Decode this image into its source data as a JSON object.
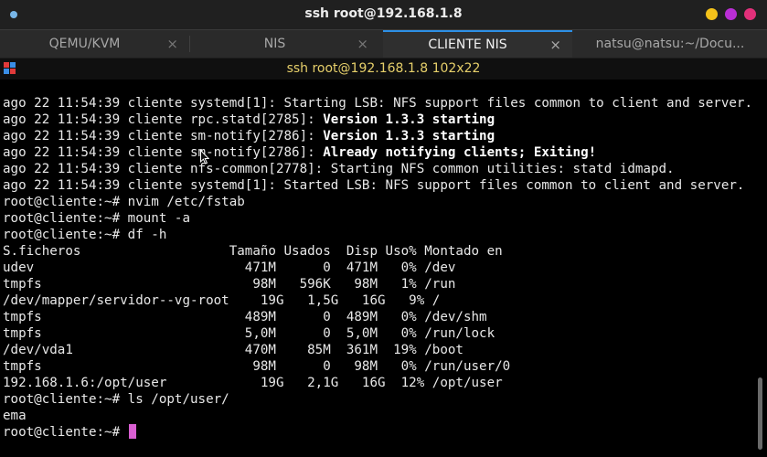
{
  "window": {
    "title": "ssh root@192.168.1.8",
    "buttons": {
      "minimize_color": "#f4c21a",
      "maximize_color": "#b92ed5",
      "close_color": "#e2307a"
    }
  },
  "tabs": [
    {
      "label": "QEMU/KVM",
      "active": false,
      "close_icon": "×"
    },
    {
      "label": "NIS",
      "active": false,
      "close_icon": "×"
    },
    {
      "label": "CLIENTE NIS",
      "active": true,
      "close_icon": "×"
    },
    {
      "label": "natsu@natsu:~/Docu...",
      "active": false,
      "close_icon": "×"
    }
  ],
  "terminal_header": {
    "title": "ssh root@192.168.1.8 102x22",
    "icon": "terminal-app-icon"
  },
  "terminal": {
    "lines": [
      {
        "pre": "ago 22 11:54:39 cliente systemd[1]: Starting LSB: NFS support files common to client and server...",
        "bold": ""
      },
      {
        "pre": "ago 22 11:54:39 cliente rpc.statd[2785]: ",
        "bold": "Version 1.3.3 starting"
      },
      {
        "pre": "ago 22 11:54:39 cliente sm-notify[2786]: ",
        "bold": "Version 1.3.3 starting"
      },
      {
        "pre": "ago 22 11:54:39 cliente sm-notify[2786]: ",
        "bold": "Already notifying clients; Exiting!"
      },
      {
        "pre": "ago 22 11:54:39 cliente nfs-common[2778]: Starting NFS common utilities: statd idmapd.",
        "bold": ""
      },
      {
        "pre": "ago 22 11:54:39 cliente systemd[1]: Started LSB: NFS support files common to client and server.",
        "bold": ""
      },
      {
        "pre": "root@cliente:~# nvim /etc/fstab",
        "bold": ""
      },
      {
        "pre": "root@cliente:~# mount -a",
        "bold": ""
      },
      {
        "pre": "root@cliente:~# df -h",
        "bold": ""
      },
      {
        "pre": "S.ficheros                   Tamaño Usados  Disp Uso% Montado en",
        "bold": ""
      },
      {
        "pre": "udev                           471M      0  471M   0% /dev",
        "bold": ""
      },
      {
        "pre": "tmpfs                           98M   596K   98M   1% /run",
        "bold": ""
      },
      {
        "pre": "/dev/mapper/servidor--vg-root    19G   1,5G   16G   9% /",
        "bold": ""
      },
      {
        "pre": "tmpfs                          489M      0  489M   0% /dev/shm",
        "bold": ""
      },
      {
        "pre": "tmpfs                          5,0M      0  5,0M   0% /run/lock",
        "bold": ""
      },
      {
        "pre": "/dev/vda1                      470M    85M  361M  19% /boot",
        "bold": ""
      },
      {
        "pre": "tmpfs                           98M      0   98M   0% /run/user/0",
        "bold": ""
      },
      {
        "pre": "192.168.1.6:/opt/user            19G   2,1G   16G  12% /opt/user",
        "bold": ""
      },
      {
        "pre": "root@cliente:~# ls /opt/user/",
        "bold": ""
      },
      {
        "pre": "ema",
        "bold": ""
      }
    ],
    "prompt": "root@cliente:~# ",
    "cursor_color": "#d95fd1"
  }
}
